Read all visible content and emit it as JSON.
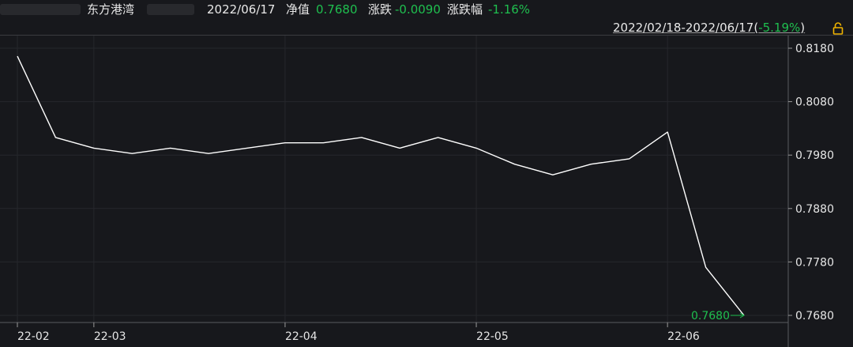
{
  "header": {
    "fund_name": "东方港湾",
    "date": "2022/06/17",
    "nav_label": "净值",
    "nav_value": "0.7680",
    "change_label": "涨跌",
    "change_value": "-0.0090",
    "change_pct_label": "涨跌幅",
    "change_pct_value": "-1.16%"
  },
  "range": {
    "period": "2022/02/18-2022/06/17(",
    "return": "-5.19%",
    "close_paren": ")"
  },
  "colors": {
    "background": "#17181c",
    "line": "#ffffff",
    "grid": "#26272c",
    "negative": "#1fbf4f",
    "lock": "#f0b400"
  },
  "chart_data": {
    "type": "line",
    "x": [
      "2022-02-18",
      "2022-02-25",
      "2022-03-04",
      "2022-03-11",
      "2022-03-18",
      "2022-03-25",
      "2022-04-01",
      "2022-04-08",
      "2022-04-15",
      "2022-04-22",
      "2022-04-29",
      "2022-05-06",
      "2022-05-13",
      "2022-05-20",
      "2022-05-27",
      "2022-06-02",
      "2022-06-10",
      "2022-06-17"
    ],
    "values": [
      0.8165,
      0.8013,
      0.7993,
      0.7983,
      0.7993,
      0.7983,
      0.7993,
      0.8003,
      0.8003,
      0.8013,
      0.7993,
      0.8013,
      0.7993,
      0.7963,
      0.7943,
      0.7963,
      0.7973,
      0.8023,
      0.777,
      0.768
    ],
    "last_label": "0.7680",
    "yticks": [
      "0.8180",
      "0.8080",
      "0.7980",
      "0.7880",
      "0.7780",
      "0.7680"
    ],
    "ytick_values": [
      0.818,
      0.808,
      0.798,
      0.788,
      0.778,
      0.768
    ],
    "ylim": [
      0.768,
      0.818
    ],
    "xticks": [
      "22-02",
      "22-03",
      "22-04",
      "22-05",
      "22-06"
    ],
    "xtick_indices": [
      0,
      2,
      7,
      12,
      17
    ],
    "grid": true,
    "title": "",
    "xlabel": "",
    "ylabel": ""
  }
}
